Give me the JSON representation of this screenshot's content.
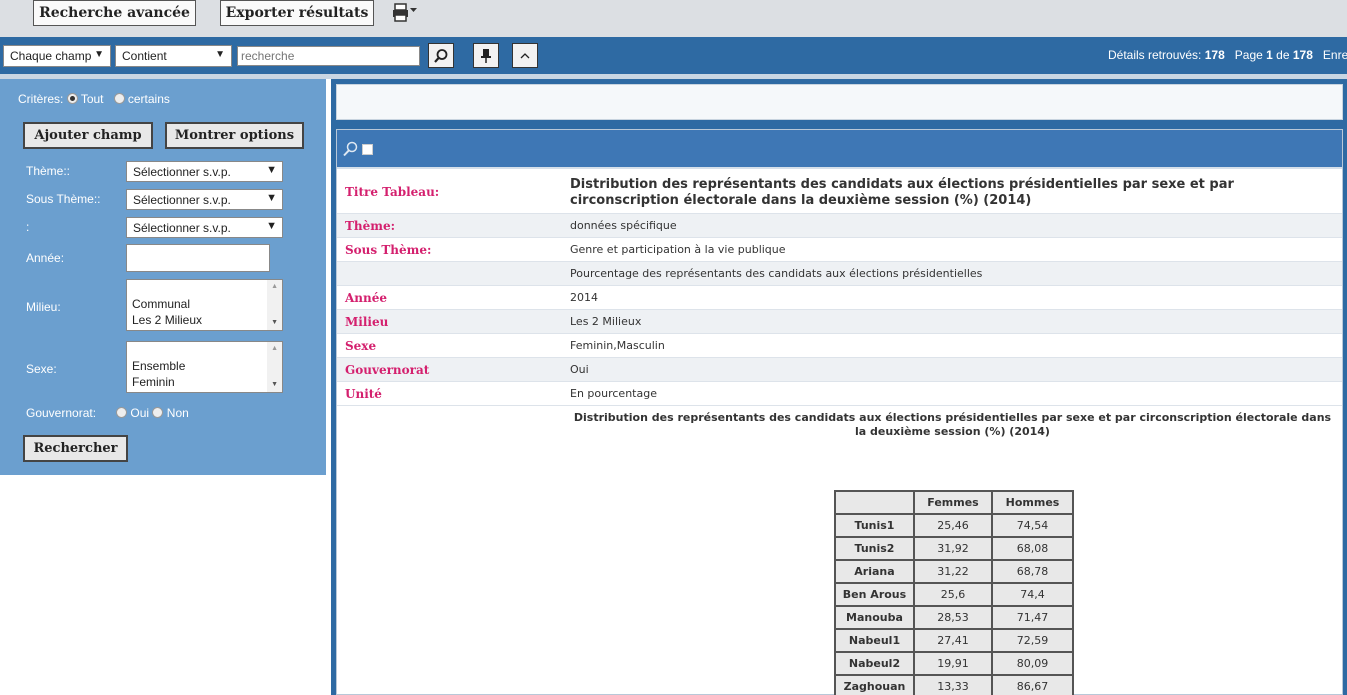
{
  "toolbar": {
    "advanced_search": "Recherche avancée",
    "export_results": "Exporter résultats"
  },
  "searchbar": {
    "field_select": "Chaque champ",
    "operator_select": "Contient",
    "search_placeholder": "recherche",
    "results_label": "Détails retrouvés:",
    "results_count": "178",
    "page_label": "Page",
    "page_current": "1",
    "page_of": "de",
    "page_total": "178",
    "trailing_text": "Enre"
  },
  "left_panel": {
    "criteria_label": "Critères:",
    "criteria_all": "Tout",
    "criteria_some": "certains",
    "add_field_button": "Ajouter champ",
    "show_options_button": "Montrer options",
    "theme_label": "Thème::",
    "theme_value": "Sélectionner s.v.p.",
    "subtheme_label": "Sous Thème::",
    "subtheme_value": "Sélectionner s.v.p.",
    "third_label": ":",
    "third_value": "Sélectionner s.v.p.",
    "year_label": "Année:",
    "milieu_label": "Milieu:",
    "milieu_options": [
      "Communal",
      "Les 2 Milieux"
    ],
    "sexe_label": "Sexe:",
    "sexe_options": [
      "Ensemble",
      "Feminin"
    ],
    "gouvernorat_label": "Gouvernorat:",
    "gouvernorat_yes": "Oui",
    "gouvernorat_no": "Non",
    "search_button": "Rechercher"
  },
  "record": {
    "title_label": "Titre Tableau:",
    "title_value": "Distribution des représentants des candidats aux élections présidentielles par sexe et par circonscription électorale dans la deuxième session (%) (2014)",
    "theme_label": "Thème:",
    "theme_value": "données spécifique",
    "subtheme_label": "Sous Thème:",
    "subtheme_value": "Genre et participation à la vie publique",
    "extra_value": "Pourcentage des représentants des candidats aux élections présidentielles",
    "year_label": "Année",
    "year_value": "2014",
    "milieu_label": "Milieu",
    "milieu_value": "Les 2 Milieux",
    "sexe_label": "Sexe",
    "sexe_value": "Feminin,Masculin",
    "gouvernorat_label": "Gouvernorat",
    "gouvernorat_value": "Oui",
    "unite_label": "Unité",
    "unite_value": "En pourcentage",
    "table_title": "Distribution des représentants des candidats aux élections présidentielles par sexe  et par circonscription électorale dans la deuxième session (%) (2014)"
  },
  "data_table": {
    "headers": [
      "",
      "Femmes",
      "Hommes"
    ],
    "rows": [
      [
        "Tunis1",
        "25,46",
        "74,54"
      ],
      [
        "Tunis2",
        "31,92",
        "68,08"
      ],
      [
        "Ariana",
        "31,22",
        "68,78"
      ],
      [
        "Ben Arous",
        "25,6",
        "74,4"
      ],
      [
        "Manouba",
        "28,53",
        "71,47"
      ],
      [
        "Nabeul1",
        "27,41",
        "72,59"
      ],
      [
        "Nabeul2",
        "19,91",
        "80,09"
      ],
      [
        "Zaghouan",
        "13,33",
        "86,67"
      ]
    ]
  },
  "icons": {
    "print": "printer-icon",
    "search": "magnifier-icon",
    "pin": "pin-icon",
    "collapse": "chevron-up-icon"
  },
  "colors": {
    "header_blue": "#2e6aa3",
    "panel_blue": "#6b9fcf",
    "label_pink": "#d4206e"
  }
}
